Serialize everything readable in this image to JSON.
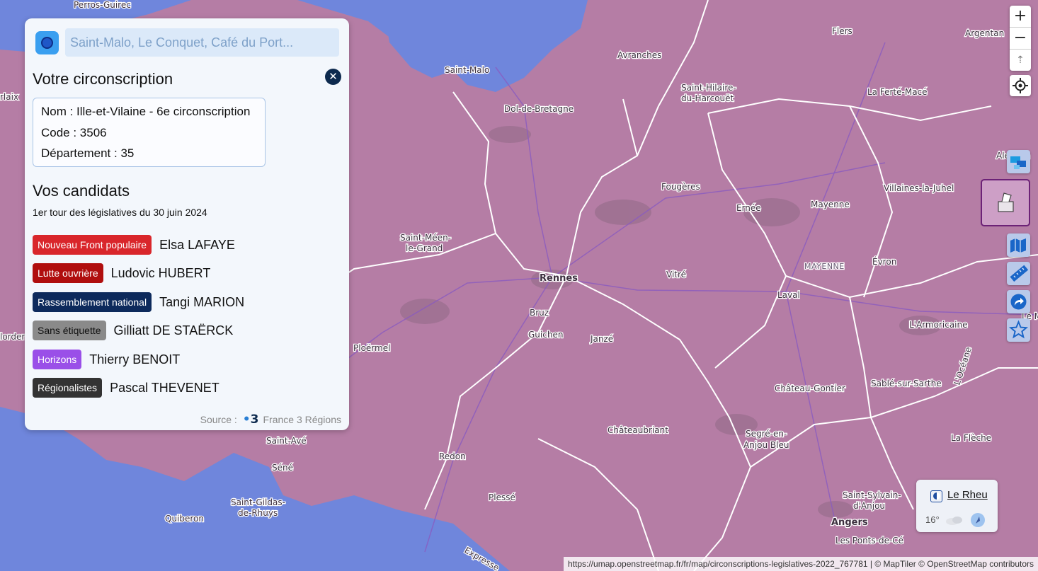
{
  "search": {
    "placeholder": "Saint-Malo, Le Conquet, Café du Port..."
  },
  "panel": {
    "title": "Votre circonscription",
    "info": {
      "nom": "Nom : Ille-et-Vilaine - 6e circonscription",
      "code": "Code : 3506",
      "departement": "Département : 35"
    },
    "candidates_title": "Vos candidats",
    "election_subtitle": "1er tour des législatives du 30 juin 2024",
    "candidates": [
      {
        "party": "Nouveau Front populaire",
        "name": "Elsa LAFAYE",
        "color": "#d9262b"
      },
      {
        "party": "Lutte ouvrière",
        "name": "Ludovic HUBERT",
        "color": "#b00e0e"
      },
      {
        "party": "Rassemblement national",
        "name": "Tangi MARION",
        "color": "#0d2a5c"
      },
      {
        "party": "Sans étiquette",
        "name": "Gilliatt DE STAËRCK",
        "color": "#8a8a8a"
      },
      {
        "party": "Horizons",
        "name": "Thierry BENOIT",
        "color": "#9a4fe8"
      },
      {
        "party": "Régionalistes",
        "name": "Pascal THEVENET",
        "color": "#333333"
      }
    ],
    "source_label": "Source :",
    "source_logo": "3",
    "source_name": "France 3 Régions"
  },
  "map": {
    "places": [
      "Perros-Guirec",
      "Saint-Malo",
      "Avranches",
      "Flers",
      "Argentan",
      "Saint-Hilaire-",
      "du-Harcouët",
      "La Ferté-Macé",
      "Dol-de-Bretagne",
      "Alençon",
      "Fougères",
      "Villaines-la-Juhel",
      "Ernée",
      "Mayenne",
      "Saint-Méen-",
      "le-Grand",
      "Rennes",
      "Vitré",
      "MAYENNE",
      "Évron",
      "Laval",
      "Bruz",
      "Guichen",
      "Janzé",
      "L'Armoricaine",
      "Ploërmel",
      "Château-Gontier",
      "Sablé-sur-Sarthe",
      "Châteaubriant",
      "Segré-en-",
      "Anjou Bleu",
      "La Flèche",
      "Saint-Avé",
      "Séné",
      "Redon",
      "Saint-Gildas-",
      "de-Rhuys",
      "Quiberon",
      "Plessé",
      "Saint-Sylvain-",
      "d'Anjou",
      "Angers",
      "Les Ponts-de-Cé",
      "lorden",
      "rlaix",
      "Le M",
      "L'Océane",
      "Expresse"
    ]
  },
  "controls": {
    "zoom_in": "+",
    "zoom_out": "−",
    "reset_north": "⇡"
  },
  "weather": {
    "town": "Le Rheu",
    "temp": "16°"
  },
  "attribution": "https://umap.openstreetmap.fr/fr/map/circonscriptions-legislatives-2022_767781 | © MapTiler © OpenStreetMap contributors",
  "colors": {
    "land": "#b57da5",
    "sea": "#6f86dc",
    "accent": "#3a9ff0",
    "close": "#0d2a4e"
  }
}
